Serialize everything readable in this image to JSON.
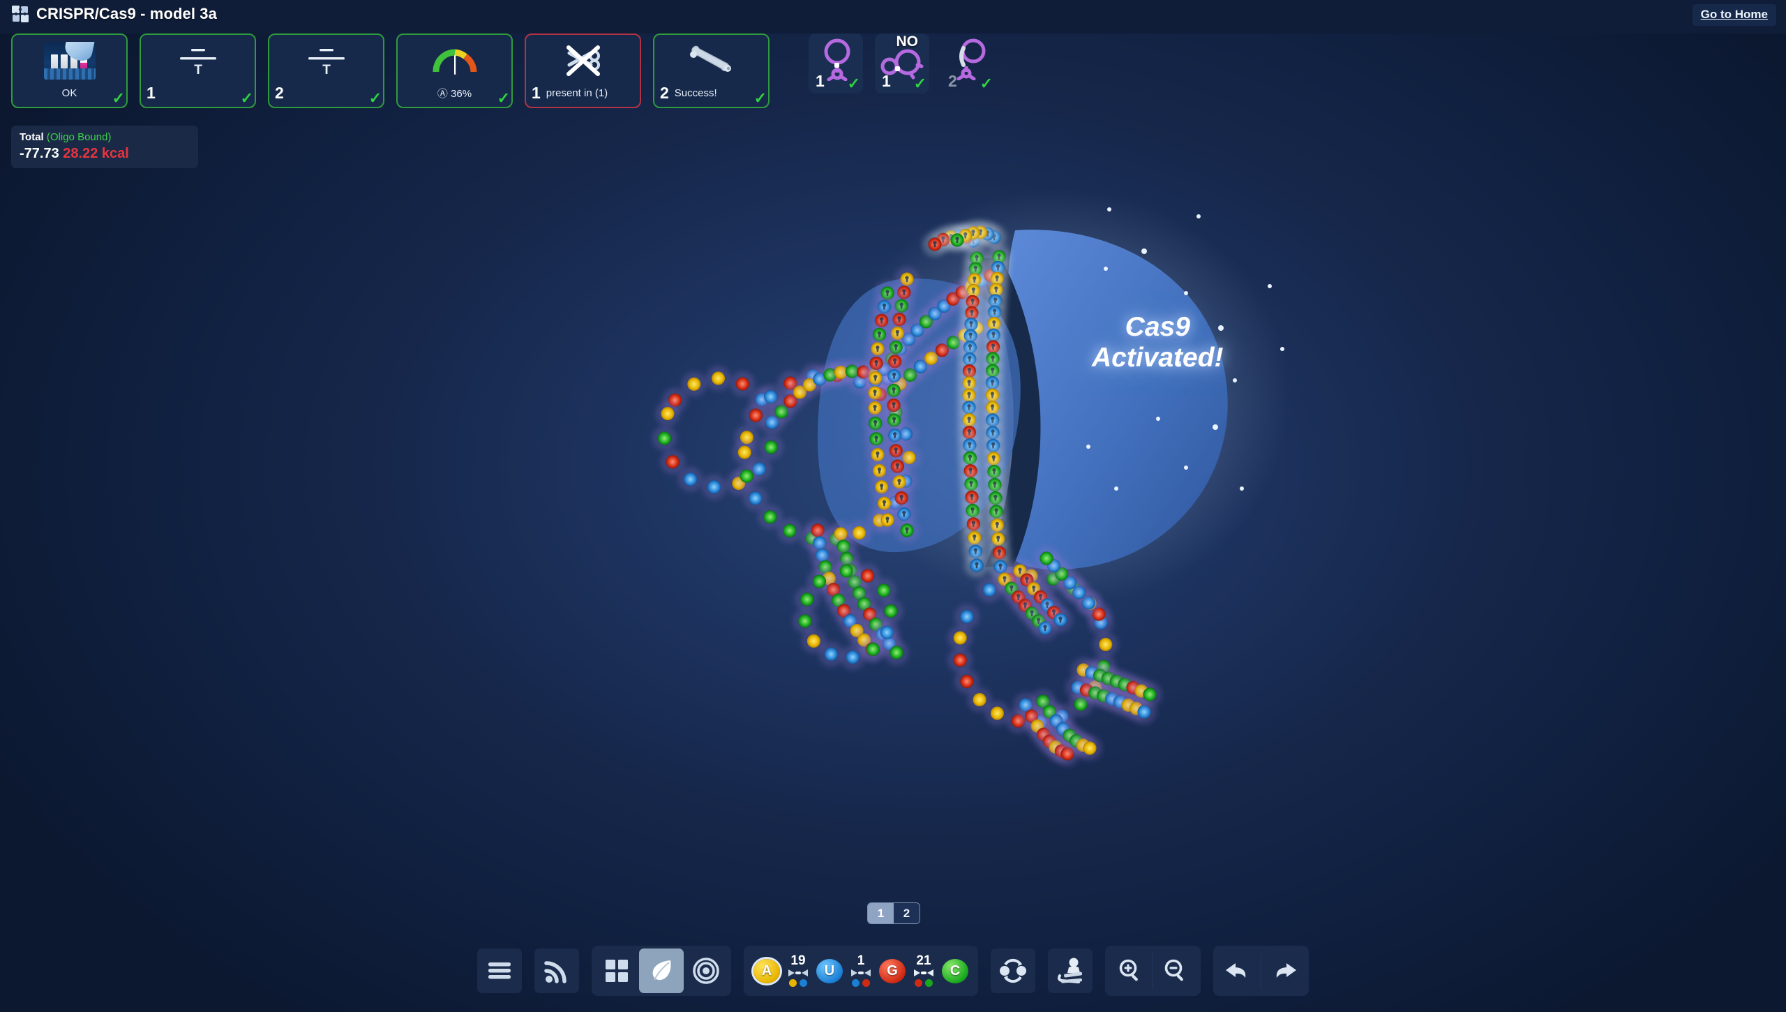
{
  "window": {
    "title": "CRISPR/Cas9 - model 3a",
    "title_icon": "puzzle-piece-icon",
    "home_link": "Go to Home",
    "background_color": "#16274b"
  },
  "constraints": [
    {
      "id": "bonus-lab",
      "icon": "test-tubes-icon",
      "number": "",
      "label": "OK",
      "status": "pass",
      "check": "✓"
    },
    {
      "id": "shape-target-1",
      "icon": "shape-target-icon",
      "number": "1",
      "label": "",
      "badge": "T",
      "status": "pass",
      "check": "✓"
    },
    {
      "id": "shape-target-2",
      "icon": "shape-target-icon",
      "number": "2",
      "label": "",
      "badge": "T",
      "status": "pass",
      "check": "✓"
    },
    {
      "id": "a-percentage",
      "icon": "gauge-icon",
      "number": "",
      "label": "Ⓐ 36%",
      "status": "pass",
      "check": "✓"
    },
    {
      "id": "no-bind-1",
      "icon": "scissors-crossed-out-icon",
      "number": "1",
      "label": "present in (1)",
      "status": "fail",
      "check": ""
    },
    {
      "id": "bind-2",
      "icon": "bone-icon",
      "number": "2",
      "label": "Success!",
      "status": "pass",
      "check": "✓"
    },
    {
      "id": "oligo-state-1",
      "icon": "oligo-loop-icon",
      "number": "1",
      "label": "",
      "status": "plain",
      "check": "✓"
    },
    {
      "id": "oligo-state-no",
      "icon": "oligo-double-loop-icon",
      "number": "1",
      "label": "",
      "badge": "NO",
      "status": "plain",
      "check": "✓"
    },
    {
      "id": "oligo-state-2",
      "icon": "oligo-bound-icon",
      "number": "2",
      "label": "",
      "status": "plain-dim",
      "check": "✓"
    }
  ],
  "energy": {
    "title": "Total",
    "state": "(Oligo Bound)",
    "value": "-77.73",
    "error": "28.22 kcal"
  },
  "scene": {
    "overlay_line1": "Cas9",
    "overlay_line2": "Activated!",
    "protein_color": "#4b7ac9",
    "nucleotide_colors": {
      "A": "#e8b400",
      "U": "#1b7fd4",
      "G": "#cf2a14",
      "C": "#18a81e"
    }
  },
  "pager": {
    "pages": [
      "1",
      "2"
    ],
    "active": "1"
  },
  "toolbar": {
    "left_group": [
      {
        "id": "menu",
        "icon": "hamburger-menu-icon",
        "active": false
      },
      {
        "id": "signal",
        "icon": "rss-signal-icon",
        "active": false
      }
    ],
    "view_group": [
      {
        "id": "grid",
        "icon": "grid-layout-icon",
        "active": false
      },
      {
        "id": "leaf",
        "icon": "leaf-icon",
        "active": true
      },
      {
        "id": "target",
        "icon": "target-rings-icon",
        "active": false
      }
    ],
    "palette": {
      "nucleotides": [
        {
          "letter": "A",
          "class": "a",
          "selected": true
        },
        {
          "letter": "U",
          "class": "u",
          "selected": false
        },
        {
          "letter": "G",
          "class": "g",
          "selected": false
        },
        {
          "letter": "C",
          "class": "c",
          "selected": false
        }
      ],
      "pairs": [
        {
          "count": "19",
          "dots": [
            "#e8b400",
            "#1b7fd4"
          ]
        },
        {
          "count": "1",
          "dots": [
            "#1b7fd4",
            "#cf2a14"
          ]
        },
        {
          "count": "21",
          "dots": [
            "#cf2a14",
            "#18a81e"
          ]
        }
      ]
    },
    "swap_group": [
      {
        "id": "swap",
        "icon": "swap-pair-icon",
        "active": false
      },
      {
        "id": "stamp",
        "icon": "stamp-icon",
        "active": false
      }
    ],
    "zoom_group": [
      {
        "id": "zoom-in",
        "icon": "zoom-in-icon",
        "active": false
      },
      {
        "id": "zoom-out",
        "icon": "zoom-out-icon",
        "active": false
      }
    ],
    "history_group": [
      {
        "id": "undo",
        "icon": "undo-arrow-icon",
        "active": false
      },
      {
        "id": "redo",
        "icon": "redo-arrow-icon",
        "active": false
      }
    ]
  }
}
